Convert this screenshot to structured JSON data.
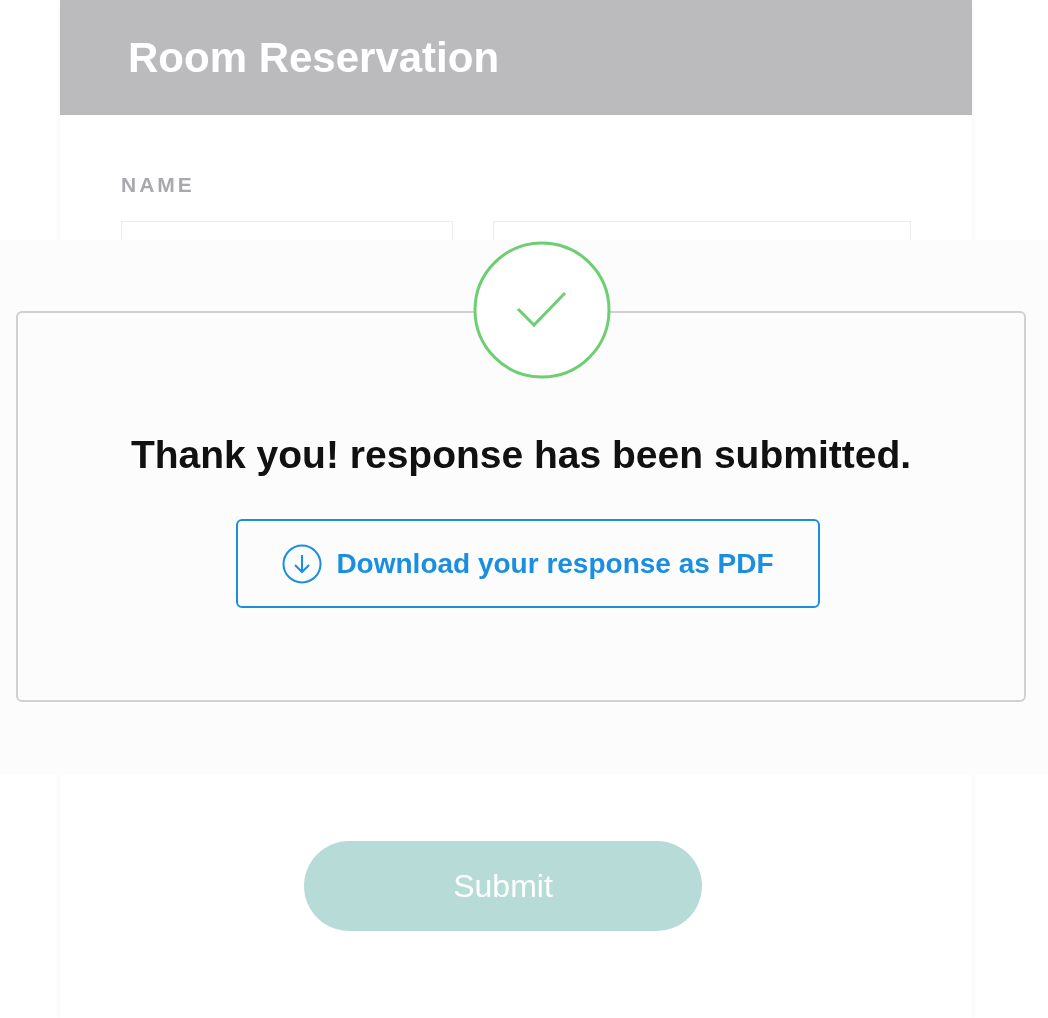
{
  "form": {
    "title": "Room Reservation",
    "name_label": "NAME",
    "submit_button": "Submit"
  },
  "dialog": {
    "message": "Thank you! response has been submitted.",
    "download_button": "Download your response as PDF"
  }
}
